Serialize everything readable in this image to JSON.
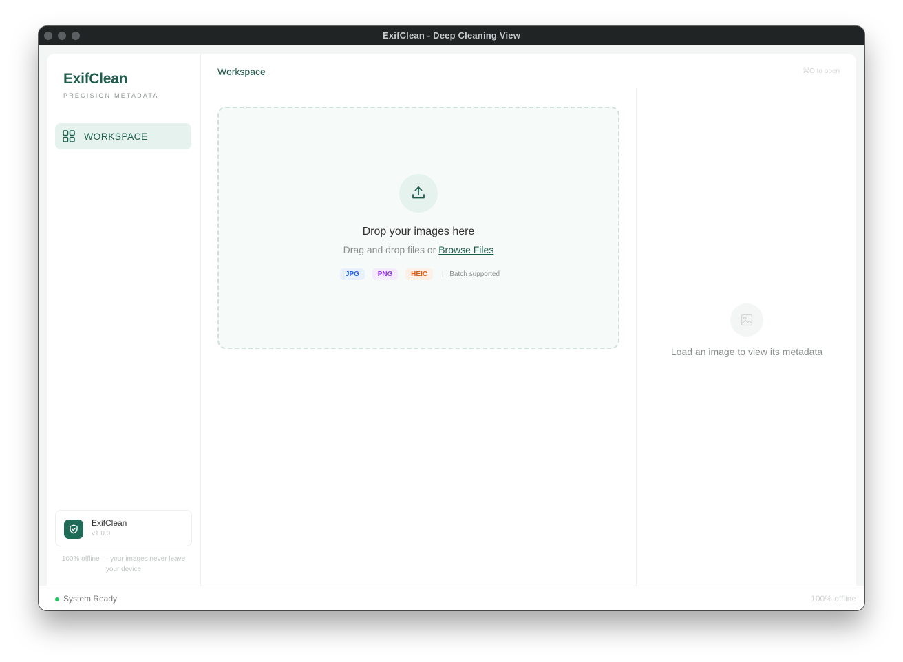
{
  "window": {
    "title": "ExifClean - Deep Cleaning View"
  },
  "sidebar": {
    "brand_name": "ExifClean",
    "brand_tagline": "PRECISION METADATA",
    "items": [
      {
        "label": "WORKSPACE",
        "icon": "grid-icon",
        "active": true
      }
    ],
    "app_info": {
      "name": "ExifClean",
      "version": "v1.0.0",
      "icon": "shield-icon"
    },
    "offline_note": "100% offline — your images never leave your device"
  },
  "main": {
    "page_title": "Workspace",
    "shortcut_hint": "⌘O to open",
    "dropzone": {
      "icon": "upload-icon",
      "title": "Drop your images here",
      "subtitle_prefix": "Drag and drop files or",
      "browse_label": "Browse Files",
      "formats": [
        "JPG",
        "PNG",
        "HEIC"
      ],
      "batch_note": "Batch supported"
    },
    "metadata_panel": {
      "icon": "image-icon",
      "placeholder": "Load an image to view its metadata"
    }
  },
  "status_bar": {
    "status": "System Ready",
    "mode": "100% offline"
  },
  "colors": {
    "accent": "#1f5c4c",
    "accent_light": "#e6f2ee",
    "status_ok": "#22c55e",
    "jpg": "#2563eb",
    "png": "#9333ea",
    "heic": "#ea580c"
  }
}
